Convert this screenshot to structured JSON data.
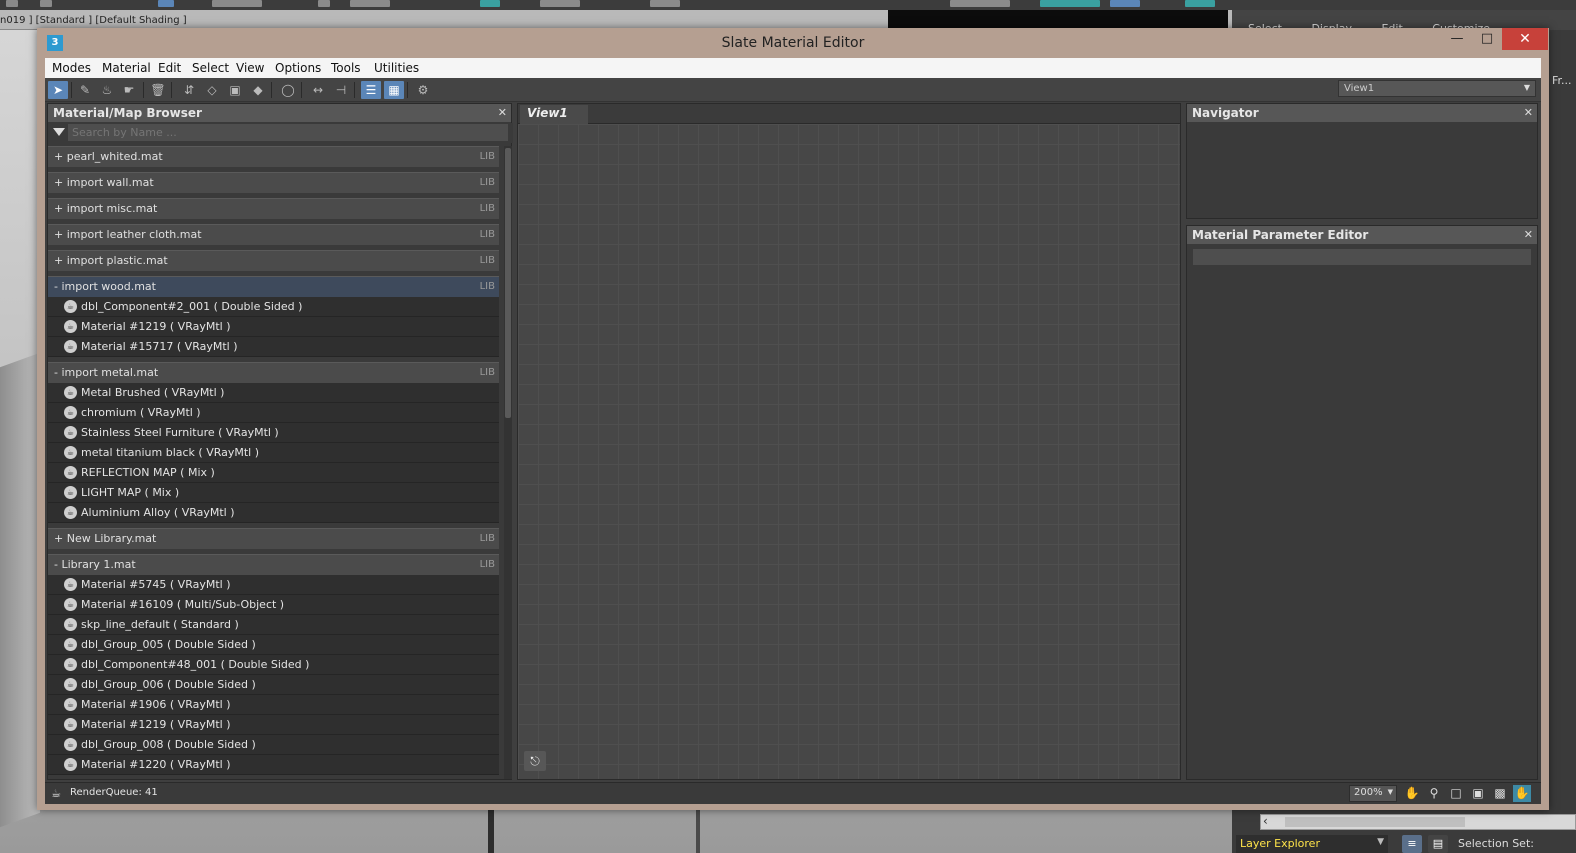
{
  "host": {
    "viewport_label": "n019 ] [Standard ] [Default Shading ]",
    "menu": [
      "Select",
      "Display",
      "Edit",
      "Customize"
    ],
    "side_label": "Fr...",
    "layer_explorer": "Layer Explorer",
    "selection_set": "Selection Set:"
  },
  "window": {
    "title": "Slate Material Editor",
    "app_icon": "3"
  },
  "menubar": [
    "Modes",
    "Material",
    "Edit",
    "Select",
    "View",
    "Options",
    "Tools",
    "Utilities"
  ],
  "toolbar": {
    "view_select": "View1"
  },
  "browser": {
    "title": "Material/Map Browser",
    "search_placeholder": "Search by Name ...",
    "groups": [
      {
        "label": "+ pearl_whited.mat",
        "tag": "LIB",
        "items": []
      },
      {
        "label": "+ import wall.mat",
        "tag": "LIB",
        "items": []
      },
      {
        "label": "+ import misc.mat",
        "tag": "LIB",
        "items": []
      },
      {
        "label": "+ import leather cloth.mat",
        "tag": "LIB",
        "items": []
      },
      {
        "label": "+ import plastic.mat",
        "tag": "LIB",
        "items": []
      },
      {
        "label": "- import wood.mat",
        "tag": "LIB",
        "selected": true,
        "items": [
          "dbl_Component#2_001  ( Double Sided )",
          "Material #1219  ( VRayMtl )",
          "Material #15717  ( VRayMtl )"
        ]
      },
      {
        "label": "- import metal.mat",
        "tag": "LIB",
        "items": [
          "Metal Brushed  ( VRayMtl )",
          "chromium  ( VRayMtl )",
          "Stainless Steel Furniture  ( VRayMtl )",
          "metal titanium black  ( VRayMtl )",
          "REFLECTION MAP  ( Mix )",
          "LIGHT MAP  ( Mix )",
          "Aluminium Alloy  ( VRayMtl )"
        ]
      },
      {
        "label": "+ New Library.mat",
        "tag": "LIB",
        "items": []
      },
      {
        "label": "- Library 1.mat",
        "tag": "LIB",
        "items": [
          "Material #5745  ( VRayMtl )",
          "Material #16109  ( Multi/Sub-Object )",
          "skp_line_default  ( Standard )",
          "dbl_Group_005  ( Double Sided )",
          "dbl_Component#48_001  ( Double Sided )",
          "dbl_Group_006  ( Double Sided )",
          "Material #1906  ( VRayMtl )",
          "Material #1219  ( VRayMtl )",
          "dbl_Group_008  ( Double Sided )",
          "Material #1220  ( VRayMtl )"
        ]
      }
    ]
  },
  "view": {
    "tab": "View1"
  },
  "navigator": {
    "title": "Navigator"
  },
  "mpe": {
    "title": "Material Parameter Editor"
  },
  "status": {
    "render_queue": "RenderQueue: 41",
    "zoom": "200%"
  },
  "colors": {
    "window_frame": "#b59f91",
    "panel_bg": "#3a3a3a",
    "active_button": "#5b86b8",
    "close_button": "#c7413a",
    "layer_explorer_text": "#ffe44a"
  }
}
